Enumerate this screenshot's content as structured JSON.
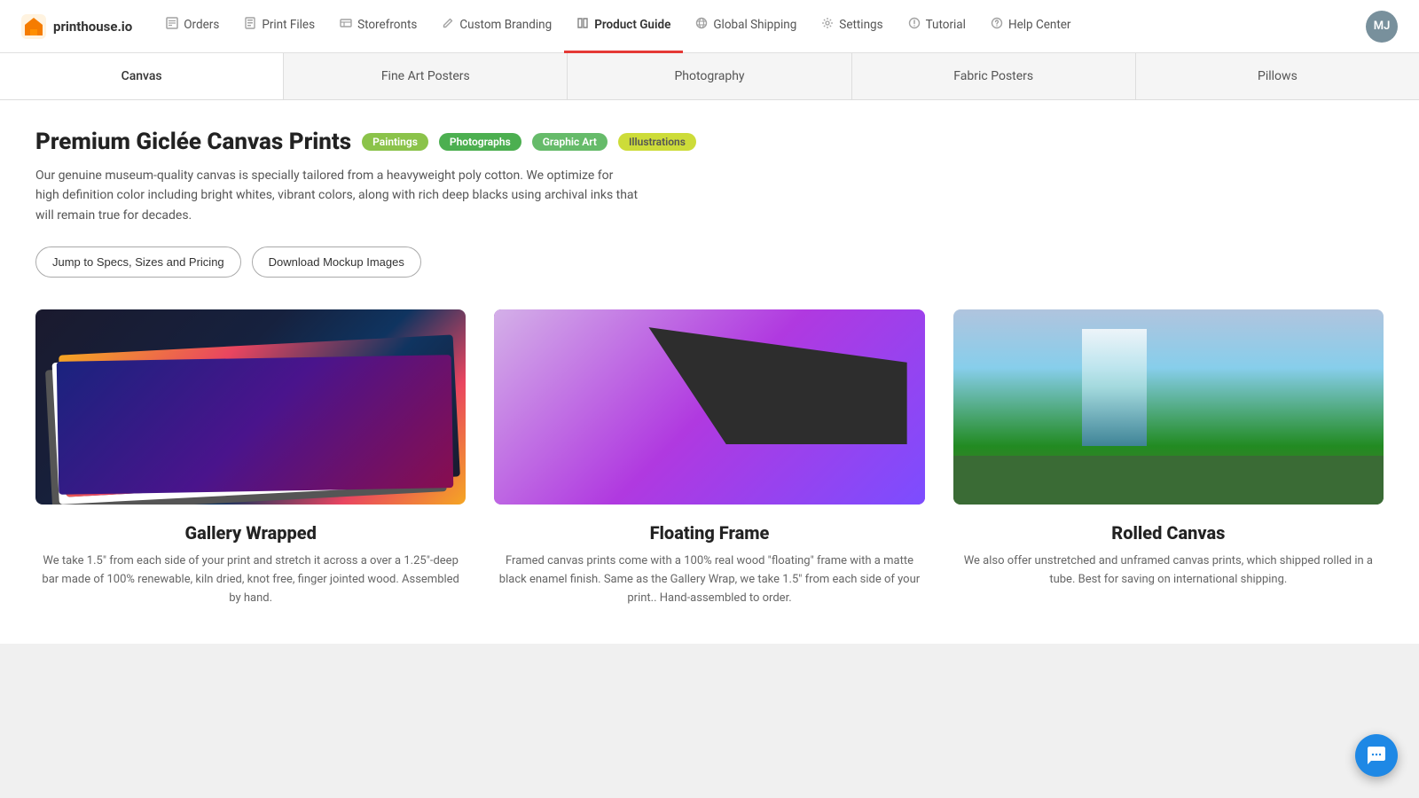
{
  "logo": {
    "text": "printhouse.io"
  },
  "nav": {
    "items": [
      {
        "id": "orders",
        "label": "Orders",
        "icon": "📋",
        "active": false
      },
      {
        "id": "print-files",
        "label": "Print Files",
        "icon": "🖨️",
        "active": false
      },
      {
        "id": "storefronts",
        "label": "Storefronts",
        "icon": "📅",
        "active": false
      },
      {
        "id": "custom-branding",
        "label": "Custom Branding",
        "icon": "✏️",
        "active": false
      },
      {
        "id": "product-guide",
        "label": "Product Guide",
        "icon": "📖",
        "active": true
      },
      {
        "id": "global-shipping",
        "label": "Global Shipping",
        "icon": "🌐",
        "active": false
      },
      {
        "id": "settings",
        "label": "Settings",
        "icon": "⚙️",
        "active": false
      },
      {
        "id": "tutorial",
        "label": "Tutorial",
        "icon": "💡",
        "active": false
      },
      {
        "id": "help-center",
        "label": "Help Center",
        "icon": "❓",
        "active": false
      }
    ],
    "avatar": "MJ"
  },
  "product_tabs": [
    {
      "id": "canvas",
      "label": "Canvas",
      "active": true
    },
    {
      "id": "fine-art-posters",
      "label": "Fine Art Posters",
      "active": false
    },
    {
      "id": "photography",
      "label": "Photography",
      "active": false
    },
    {
      "id": "fabric-posters",
      "label": "Fabric Posters",
      "active": false
    },
    {
      "id": "pillows",
      "label": "Pillows",
      "active": false
    }
  ],
  "page": {
    "title": "Premium Giclée Canvas Prints",
    "badges": [
      {
        "id": "paintings",
        "label": "Paintings",
        "class": "badge-paintings"
      },
      {
        "id": "photographs",
        "label": "Photographs",
        "class": "badge-photographs"
      },
      {
        "id": "graphic-art",
        "label": "Graphic Art",
        "class": "badge-graphic"
      },
      {
        "id": "illustrations",
        "label": "Illustrations",
        "class": "badge-illustrations"
      }
    ],
    "description": "Our genuine museum-quality canvas is specially tailored from a heavyweight poly cotton.\nWe optimize for high definition color including bright whites, vibrant colors, along with\nrich deep blacks using archival inks that will remain true for decades.",
    "buttons": [
      {
        "id": "jump-specs",
        "label": "Jump to Specs, Sizes and Pricing"
      },
      {
        "id": "download-mockup",
        "label": "Download Mockup Images"
      }
    ],
    "cards": [
      {
        "id": "gallery-wrapped",
        "title": "Gallery Wrapped",
        "description": "We take 1.5\" from each side of your print and stretch it across a over a 1.25\"-deep bar made of 100% renewable, kiln dried, knot free, finger jointed wood. Assembled by hand.",
        "image_type": "canvas-stack"
      },
      {
        "id": "floating-frame",
        "title": "Floating Frame",
        "description": "Framed canvas prints come with a 100% real wood \"floating\" frame with a matte black enamel finish. Same as the Gallery Wrap, we take 1.5\" from each side of your print.. Hand-assembled to order.",
        "image_type": "purple-frame"
      },
      {
        "id": "rolled-canvas",
        "title": "Rolled Canvas",
        "description": "We also offer unstretched and unframed canvas prints, which shipped rolled in a tube. Best for saving on international shipping.",
        "image_type": "waterfall"
      }
    ]
  },
  "chat": {
    "icon": "💬"
  }
}
